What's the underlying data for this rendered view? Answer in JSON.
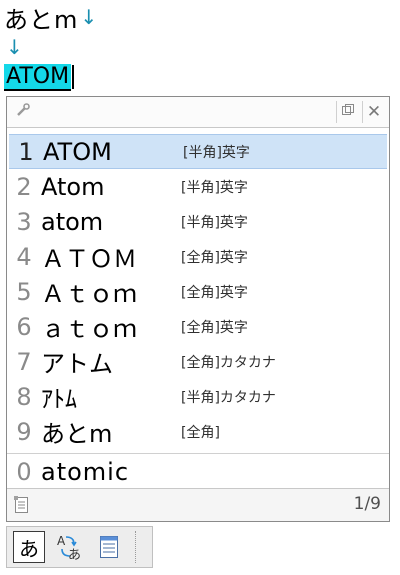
{
  "editor": {
    "line1_text": "あとm",
    "line1_arrow": "↓",
    "line2_arrow": "↓",
    "line3_text": "ATOM"
  },
  "candidates": [
    {
      "num": "1",
      "word": "ATOM",
      "info": "[半角]英字"
    },
    {
      "num": "2",
      "word": "Atom",
      "info": "[半角]英字"
    },
    {
      "num": "3",
      "word": "atom",
      "info": "[半角]英字"
    },
    {
      "num": "4",
      "word": "ＡＴＯＭ",
      "info": "[全角]英字"
    },
    {
      "num": "5",
      "word": "Ａｔｏｍ",
      "info": "[全角]英字"
    },
    {
      "num": "6",
      "word": "ａｔｏｍ",
      "info": "[全角]英字"
    },
    {
      "num": "7",
      "word": "アトム",
      "info": "[全角]カタカナ"
    },
    {
      "num": "8",
      "word": "ｱﾄﾑ",
      "info": "[半角]カタカナ"
    },
    {
      "num": "9",
      "word": "あとm",
      "info": "[全角]"
    }
  ],
  "extra": {
    "num": "0",
    "word": "atomic"
  },
  "footer": {
    "page": "1/9"
  },
  "toolbar": {
    "mode": "あ",
    "convert_icon": "A→あ",
    "menu_icon": "list-icon"
  },
  "colors": {
    "selection": "#cfe3f7",
    "conversion_highlight": "#14d8e8",
    "arrow": "#1a8fb0"
  }
}
